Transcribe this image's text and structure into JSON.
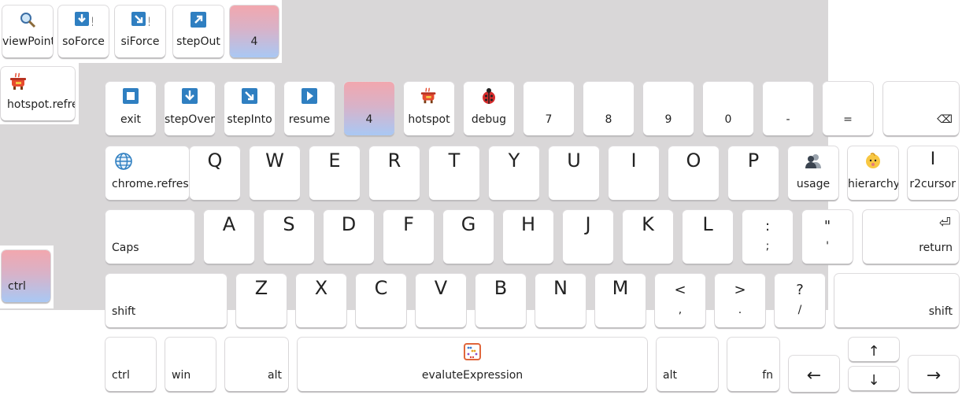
{
  "floating_row": [
    {
      "label": "viewPoint",
      "icon": "magnifier-icon"
    },
    {
      "label": "soForce",
      "icon": "force-step-over-icon"
    },
    {
      "label": "siForce",
      "icon": "force-step-into-icon"
    },
    {
      "label": "stepOut",
      "icon": "step-out-icon"
    },
    {
      "label": "4",
      "icon": ""
    }
  ],
  "floating_hotspot_refresh": {
    "label": "hotspot.refresh",
    "icon": "pot-icon"
  },
  "floating_ctrl": {
    "label": "ctrl"
  },
  "row1": [
    {
      "label": "exit",
      "icon": "stop-square-icon"
    },
    {
      "label": "stepOver",
      "icon": "step-over-icon"
    },
    {
      "label": "stepInto",
      "icon": "step-into-icon"
    },
    {
      "label": "resume",
      "icon": "play-icon"
    },
    {
      "label": "4",
      "icon": ""
    },
    {
      "label": "hotspot",
      "icon": "pot-icon"
    },
    {
      "label": "debug",
      "icon": "bug-icon"
    },
    {
      "label": "7"
    },
    {
      "label": "8"
    },
    {
      "label": "9"
    },
    {
      "label": "0"
    },
    {
      "label": "-"
    },
    {
      "label": "="
    },
    {
      "label": "⌫",
      "icon": "backspace-icon"
    }
  ],
  "row2": [
    {
      "label": "chrome.refresh",
      "icon": "globe-icon"
    },
    {
      "label": "Q"
    },
    {
      "label": "W"
    },
    {
      "label": "E"
    },
    {
      "label": "R"
    },
    {
      "label": "T"
    },
    {
      "label": "Y"
    },
    {
      "label": "U"
    },
    {
      "label": "I"
    },
    {
      "label": "O"
    },
    {
      "label": "P"
    },
    {
      "label": "usage",
      "icon": "users-icon"
    },
    {
      "label": "hierarchy",
      "icon": "baby-icon"
    },
    {
      "label": "r2cursor",
      "glyph": "I"
    }
  ],
  "row3": [
    {
      "label": "Caps"
    },
    {
      "label": "A"
    },
    {
      "label": "S"
    },
    {
      "label": "D"
    },
    {
      "label": "F"
    },
    {
      "label": "G"
    },
    {
      "label": "H"
    },
    {
      "label": "J"
    },
    {
      "label": "K"
    },
    {
      "label": "L"
    },
    {
      "top": ":",
      "bottom": ";"
    },
    {
      "top": "\"",
      "bottom": "'"
    },
    {
      "label": "return",
      "glyph": "⏎"
    }
  ],
  "row4": [
    {
      "label": "shift"
    },
    {
      "label": "Z"
    },
    {
      "label": "X"
    },
    {
      "label": "C"
    },
    {
      "label": "V"
    },
    {
      "label": "B"
    },
    {
      "label": "N"
    },
    {
      "label": "M"
    },
    {
      "top": "<",
      "bottom": ","
    },
    {
      "top": ">",
      "bottom": "."
    },
    {
      "top": "?",
      "bottom": "/"
    },
    {
      "label": "shift"
    }
  ],
  "row5": [
    {
      "label": "ctrl"
    },
    {
      "label": "win"
    },
    {
      "label": "alt"
    },
    {
      "label": "evaluteExpression",
      "icon": "abacus-icon"
    },
    {
      "label": "alt"
    },
    {
      "label": "fn"
    },
    {
      "label": "←"
    },
    {
      "label": "↑"
    },
    {
      "label": "↓"
    },
    {
      "label": "→"
    }
  ]
}
